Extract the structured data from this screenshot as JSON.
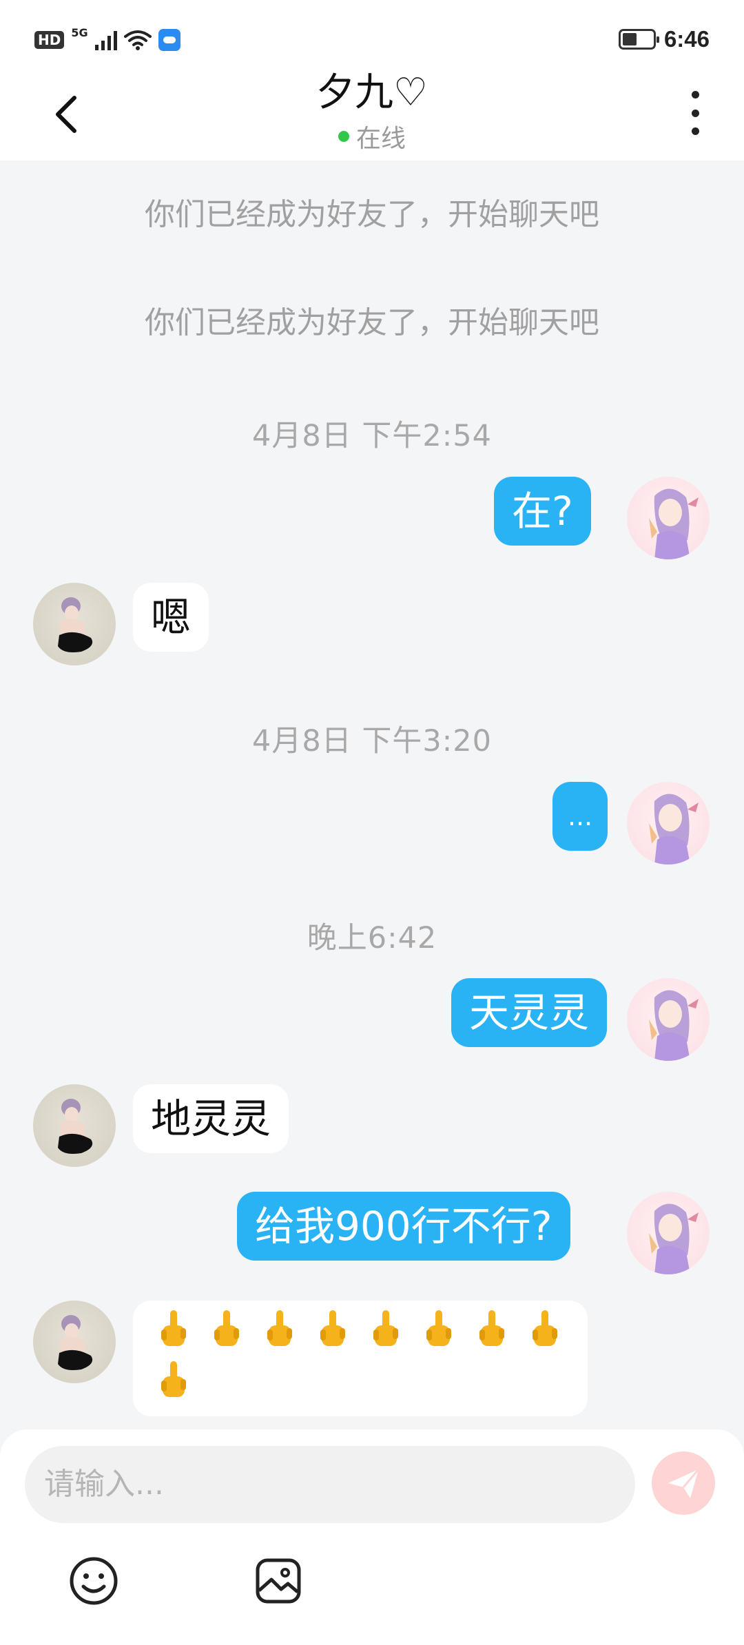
{
  "status_bar": {
    "hd": "HD",
    "network": "5G",
    "time": "6:46"
  },
  "header": {
    "title": "夕九♡",
    "status": "在线",
    "status_color": "#31c84a"
  },
  "accent_color": "#29b3f5",
  "system_messages": [
    "你们已经成为好友了，开始聊天吧",
    "你们已经成为好友了，开始聊天吧"
  ],
  "timestamps": [
    "4月8日 下午2:54",
    "4月8日 下午3:20",
    "晚上6:42"
  ],
  "messages": [
    {
      "from": "me",
      "text": "在?"
    },
    {
      "from": "them",
      "text": "嗯"
    },
    {
      "from": "me",
      "text": "..."
    },
    {
      "from": "me",
      "text": "天灵灵"
    },
    {
      "from": "them",
      "text": "地灵灵"
    },
    {
      "from": "me",
      "text": "给我900行不行?"
    },
    {
      "from": "them",
      "text": "",
      "emoji": "middle-finger-emoji",
      "emoji_count": 9
    }
  ],
  "input": {
    "placeholder": "请输入..."
  },
  "icons": {
    "back": "chevron-left-icon",
    "more": "more-vertical-icon",
    "send": "send-icon",
    "emoji": "emoji-icon",
    "image": "image-icon"
  }
}
